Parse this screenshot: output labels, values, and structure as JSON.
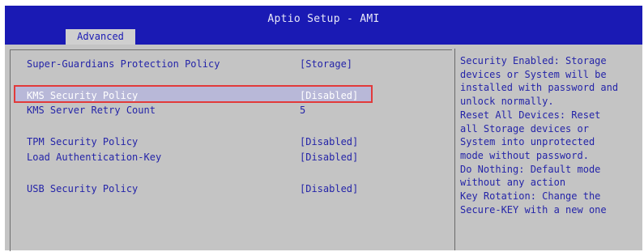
{
  "title": "Aptio Setup - AMI",
  "tab": "Advanced",
  "rows": [
    {
      "label": "Super-Guardians Protection Policy",
      "value": "[Storage]"
    },
    {
      "label": "KMS Security Policy",
      "value": "[Disabled]"
    },
    {
      "label": "KMS Server Retry Count",
      "value": "5"
    },
    {
      "label": "TPM Security Policy",
      "value": "[Disabled]"
    },
    {
      "label": "Load Authentication-Key",
      "value": "[Disabled]"
    },
    {
      "label": "USB Security Policy",
      "value": "[Disabled]"
    }
  ],
  "help_lines": [
    "Security Enabled: Storage",
    "devices or System will be",
    "installed with password and",
    "unlock normally.",
    "Reset All Devices: Reset",
    "all Storage devices or",
    "System into unprotected",
    "mode without password.",
    "Do Nothing: Default mode",
    "without any action",
    "Key Rotation: Change the",
    "Secure-KEY with a new one"
  ],
  "colors": {
    "header_blue": "#1a1ab4",
    "panel_gray": "#c4c4c4",
    "text_blue": "#2424a8",
    "highlight_red": "#e23a3a"
  }
}
